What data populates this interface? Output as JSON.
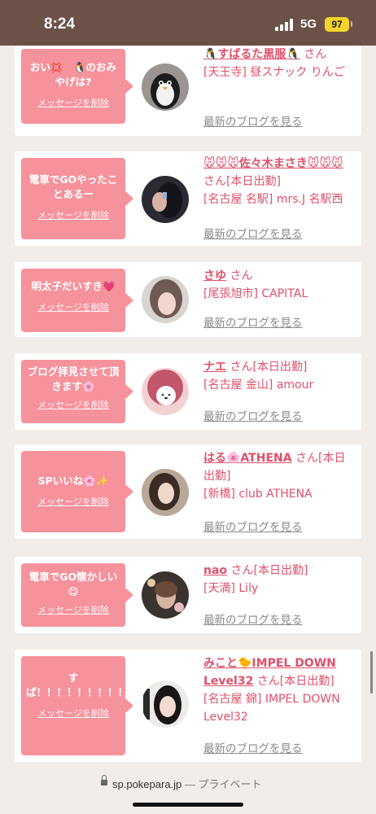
{
  "status_bar": {
    "time": "8:24",
    "network": "5G",
    "battery": "97"
  },
  "messages": [
    {
      "bubble": "おい💢　🐧のおみやげは?",
      "delete_label": "メッセージを削除",
      "name": "🐧すばるた黒服🐧",
      "suffix": "さん",
      "shop": "[天王寺] 昼スナック りんご",
      "blog_link": "最新のブログを見る",
      "avatar_icon": "penguin-avatar"
    },
    {
      "bubble": "電車でGOやったことあるー",
      "delete_label": "メッセージを削除",
      "name": "🐭🐭🐭佐々木まさき🐭🐭🐭",
      "suffix": "さん[本日出勤]",
      "shop": "[名古屋 名駅] mrs.J 名駅西",
      "blog_link": "最新のブログを見る",
      "avatar_icon": "girl-photo-avatar"
    },
    {
      "bubble": "明太子だいすき💗",
      "delete_label": "メッセージを削除",
      "name": "さゆ",
      "suffix": "さん",
      "shop": "[尾張旭市] CAPITAL",
      "blog_link": "最新のブログを見る",
      "avatar_icon": "girl-photo-avatar"
    },
    {
      "bubble": "ブログ拝見させて頂きます🌸",
      "delete_label": "メッセージを削除",
      "name": "ナエ",
      "suffix": "さん[本日出勤]",
      "shop": "[名古屋 金山] amour",
      "blog_link": "最新のブログを見る",
      "avatar_icon": "girl-photo-avatar"
    },
    {
      "bubble": "SPいいね🌸✨",
      "delete_label": "メッセージを削除",
      "name": "はる🌸ATHENA",
      "suffix": "さん[本日出勤]",
      "shop": "[新橋] club ATHENA",
      "blog_link": "最新のブログを見る",
      "avatar_icon": "girl-photo-avatar"
    },
    {
      "bubble": "電車でGO懐かしい😋",
      "delete_label": "メッセージを削除",
      "name": "nao",
      "suffix": "さん[本日出勤]",
      "shop": "[天満] Lily",
      "blog_link": "最新のブログを見る",
      "avatar_icon": "girl-photo-avatar"
    },
    {
      "bubble": "すぱ！！！！！！！！！！！！",
      "delete_label": "メッセージを削除",
      "name": "みこと🐤IMPEL DOWN Level32",
      "suffix": "さん[本日出勤]",
      "shop": "[名古屋 錦] IMPEL DOWN Level32",
      "blog_link": "最新のブログを見る",
      "avatar_icon": "girl-photo-avatar"
    }
  ],
  "url_bar": {
    "domain": "sp.pokepara.jp",
    "separator": " — ",
    "mode": "プライベート"
  },
  "colors": {
    "accent": "#e0506a",
    "bubble": "#f6929c",
    "status_bar": "#6b5147"
  }
}
